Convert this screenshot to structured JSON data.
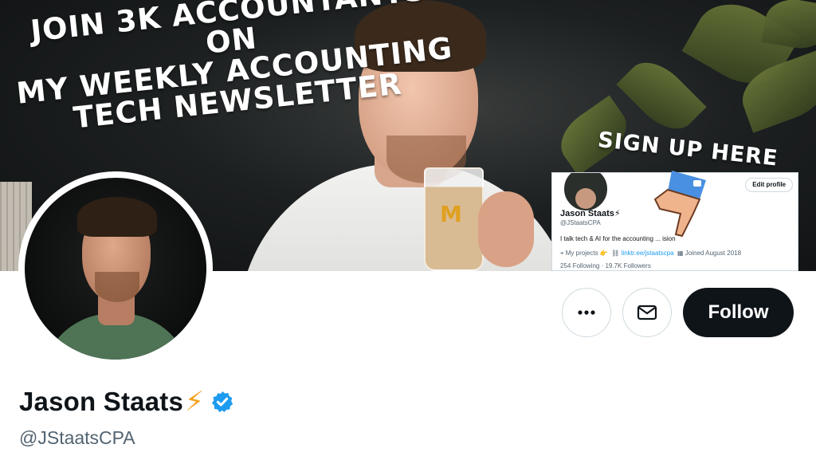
{
  "banner": {
    "headline_lines": [
      "JOIN 3K ACCOUNTANTS ON",
      "MY WEEKLY ACCOUNTING",
      "TECH NEWSLETTER"
    ],
    "cta": "SIGN UP HERE",
    "cup_logo": "M",
    "inset": {
      "edit_label": "Edit profile",
      "name": "Jason Staats⚡",
      "handle": "@JStaatsCPA",
      "bio": "I talk tech & AI for the accounting ... ision",
      "projects": "My projects 👉",
      "link": "linktr.ee/jstaatscpa",
      "joined": "Joined August 2018",
      "follows": "254 Following · 19.7K Followers"
    }
  },
  "profile": {
    "name": "Jason Staats",
    "bolt": "⚡",
    "handle": "@JStaatsCPA",
    "follow_label": "Follow"
  },
  "colors": {
    "verified": "#1d9bf0",
    "follow_bg": "#0f1419",
    "handle_text": "#536471"
  }
}
